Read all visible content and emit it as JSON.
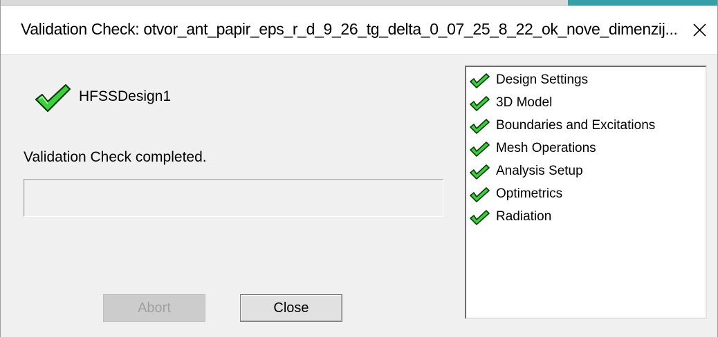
{
  "window": {
    "title": "Validation Check: otvor_ant_papir_eps_r_d_9_26_tg_delta_0_07_25_8_22_ok_nove_dimenzij...",
    "close_glyph": "✕"
  },
  "design": {
    "name": "HFSSDesign1",
    "icon": "green-check-icon"
  },
  "status": {
    "message": "Validation Check completed."
  },
  "buttons": {
    "abort_label": "Abort",
    "close_label": "Close"
  },
  "checklist": [
    {
      "label": "Design Settings",
      "icon": "green-check-icon"
    },
    {
      "label": "3D Model",
      "icon": "green-check-icon"
    },
    {
      "label": "Boundaries and Excitations",
      "icon": "green-check-icon"
    },
    {
      "label": "Mesh Operations",
      "icon": "green-check-icon"
    },
    {
      "label": "Analysis Setup",
      "icon": "green-check-icon"
    },
    {
      "label": "Optimetrics",
      "icon": "green-check-icon"
    },
    {
      "label": "Radiation",
      "icon": "green-check-icon"
    }
  ],
  "colors": {
    "check_fill": "#3ad13a",
    "check_outline": "#0a3a0a",
    "window_bg": "#f0f0f0"
  }
}
